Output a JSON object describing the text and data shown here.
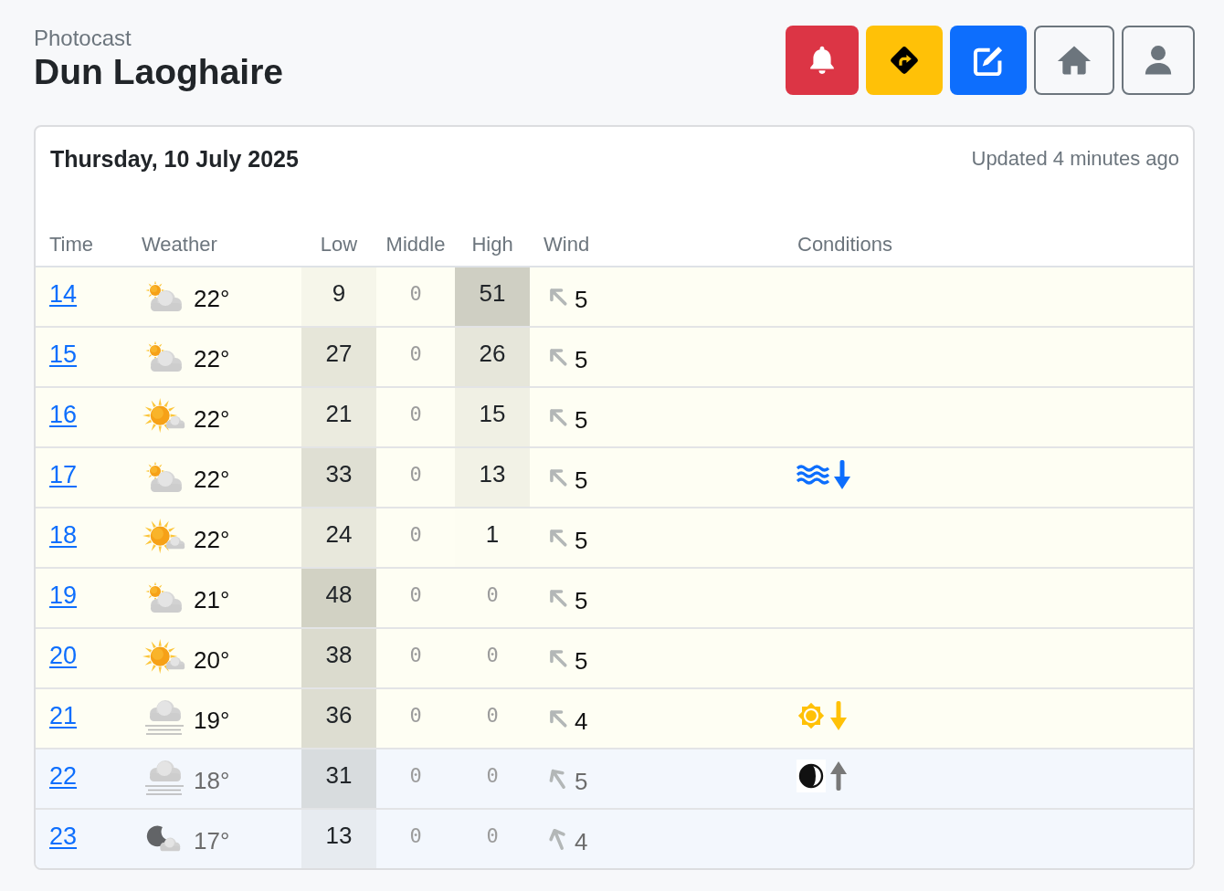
{
  "header": {
    "app_name": "Photocast",
    "location": "Dun Laoghaire"
  },
  "card": {
    "date": "Thursday, 10 July 2025",
    "updated": "Updated 4 minutes ago"
  },
  "table": {
    "columns": [
      "Time",
      "Weather",
      "Low",
      "Middle",
      "High",
      "Wind",
      "Conditions"
    ],
    "rows": [
      {
        "time": "14",
        "night": false,
        "weather": {
          "kind": "mostly-cloudy",
          "temperature": "22°"
        },
        "low": "9",
        "middle": "0",
        "high": "51",
        "wind": {
          "kind": "nw",
          "speed": "5"
        }
      },
      {
        "time": "15",
        "night": false,
        "weather": {
          "kind": "mostly-cloudy",
          "temperature": "22°"
        },
        "low": "27",
        "middle": "0",
        "high": "26",
        "wind": {
          "kind": "nw",
          "speed": "5"
        }
      },
      {
        "time": "16",
        "night": false,
        "weather": {
          "kind": "partly-sunny",
          "temperature": "22°"
        },
        "low": "21",
        "middle": "0",
        "high": "15",
        "wind": {
          "kind": "nw",
          "speed": "5"
        }
      },
      {
        "time": "17",
        "night": false,
        "weather": {
          "kind": "mostly-cloudy",
          "temperature": "22°"
        },
        "low": "33",
        "middle": "0",
        "high": "13",
        "wind": {
          "kind": "nw",
          "speed": "5"
        },
        "conditions": [
          {
            "kind": "tide-falling"
          }
        ]
      },
      {
        "time": "18",
        "night": false,
        "weather": {
          "kind": "partly-sunny",
          "temperature": "22°"
        },
        "low": "24",
        "middle": "0",
        "high": "1",
        "wind": {
          "kind": "nw",
          "speed": "5"
        }
      },
      {
        "time": "19",
        "night": false,
        "weather": {
          "kind": "mostly-cloudy",
          "temperature": "21°"
        },
        "low": "48",
        "middle": "0",
        "high": "0",
        "wind": {
          "kind": "nw",
          "speed": "5"
        }
      },
      {
        "time": "20",
        "night": false,
        "weather": {
          "kind": "partly-sunny",
          "temperature": "20°"
        },
        "low": "38",
        "middle": "0",
        "high": "0",
        "wind": {
          "kind": "nw",
          "speed": "5"
        }
      },
      {
        "time": "21",
        "night": false,
        "weather": {
          "kind": "fog",
          "temperature": "19°"
        },
        "low": "36",
        "middle": "0",
        "high": "0",
        "wind": {
          "kind": "nw",
          "speed": "4"
        },
        "conditions": [
          {
            "kind": "sunset"
          }
        ]
      },
      {
        "time": "22",
        "night": true,
        "weather": {
          "kind": "fog",
          "temperature": "18°"
        },
        "low": "31",
        "middle": "0",
        "high": "0",
        "wind": {
          "kind": "nwbn",
          "speed": "5"
        },
        "conditions": [
          {
            "kind": "moonrise"
          }
        ]
      },
      {
        "time": "23",
        "night": true,
        "weather": {
          "kind": "moon-cloud",
          "temperature": "17°"
        },
        "low": "13",
        "middle": "0",
        "high": "0",
        "wind": {
          "kind": "nnw",
          "speed": "4"
        }
      }
    ]
  }
}
